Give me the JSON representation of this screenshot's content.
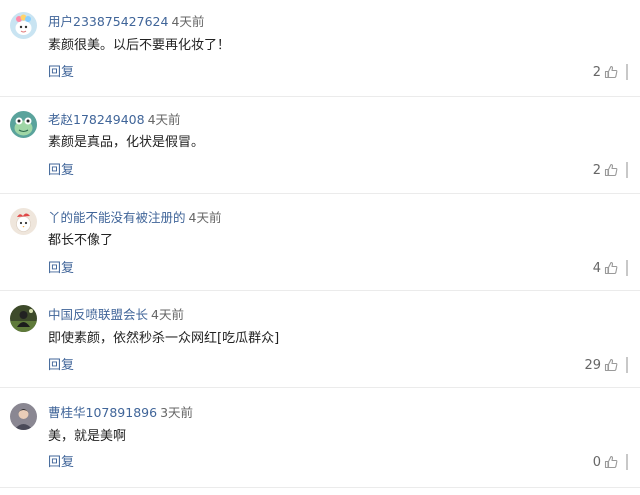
{
  "comments": [
    {
      "user": "用户233875427624",
      "time": "4天前",
      "text": "素颜很美。以后不要再化妆了！",
      "reply_label": "回复",
      "likes": "2",
      "avatar_icon": "flower-cartoon-avatar-icon",
      "avatar_color": "#c9e4f2"
    },
    {
      "user": "老赵178249408",
      "time": "4天前",
      "text": "素颜是真品，化状是假冒。",
      "reply_label": "回复",
      "likes": "2",
      "avatar_icon": "frog-cartoon-avatar-icon",
      "avatar_color": "#5aa39c"
    },
    {
      "user": "丫的能不能没有被注册的",
      "time": "4天前",
      "text": "都长不像了",
      "reply_label": "回复",
      "likes": "4",
      "avatar_icon": "bird-cartoon-avatar-icon",
      "avatar_color": "#efe6dc"
    },
    {
      "user": "中国反喷联盟会长",
      "time": "4天前",
      "text": "即使素颜，依然秒杀一众网红[吃瓜群众]",
      "reply_label": "回复",
      "likes": "29",
      "avatar_icon": "photo-avatar-icon",
      "avatar_color": "#3d4a2a"
    },
    {
      "user": "曹桂华107891896",
      "time": "3天前",
      "text": "美，就是美啊",
      "reply_label": "回复",
      "likes": "0",
      "avatar_icon": "portrait-avatar-icon",
      "avatar_color": "#8a8792"
    }
  ],
  "colors": {
    "username": "#406599",
    "reply": "#406599",
    "meta": "#666666",
    "divider": "#ebebeb"
  }
}
